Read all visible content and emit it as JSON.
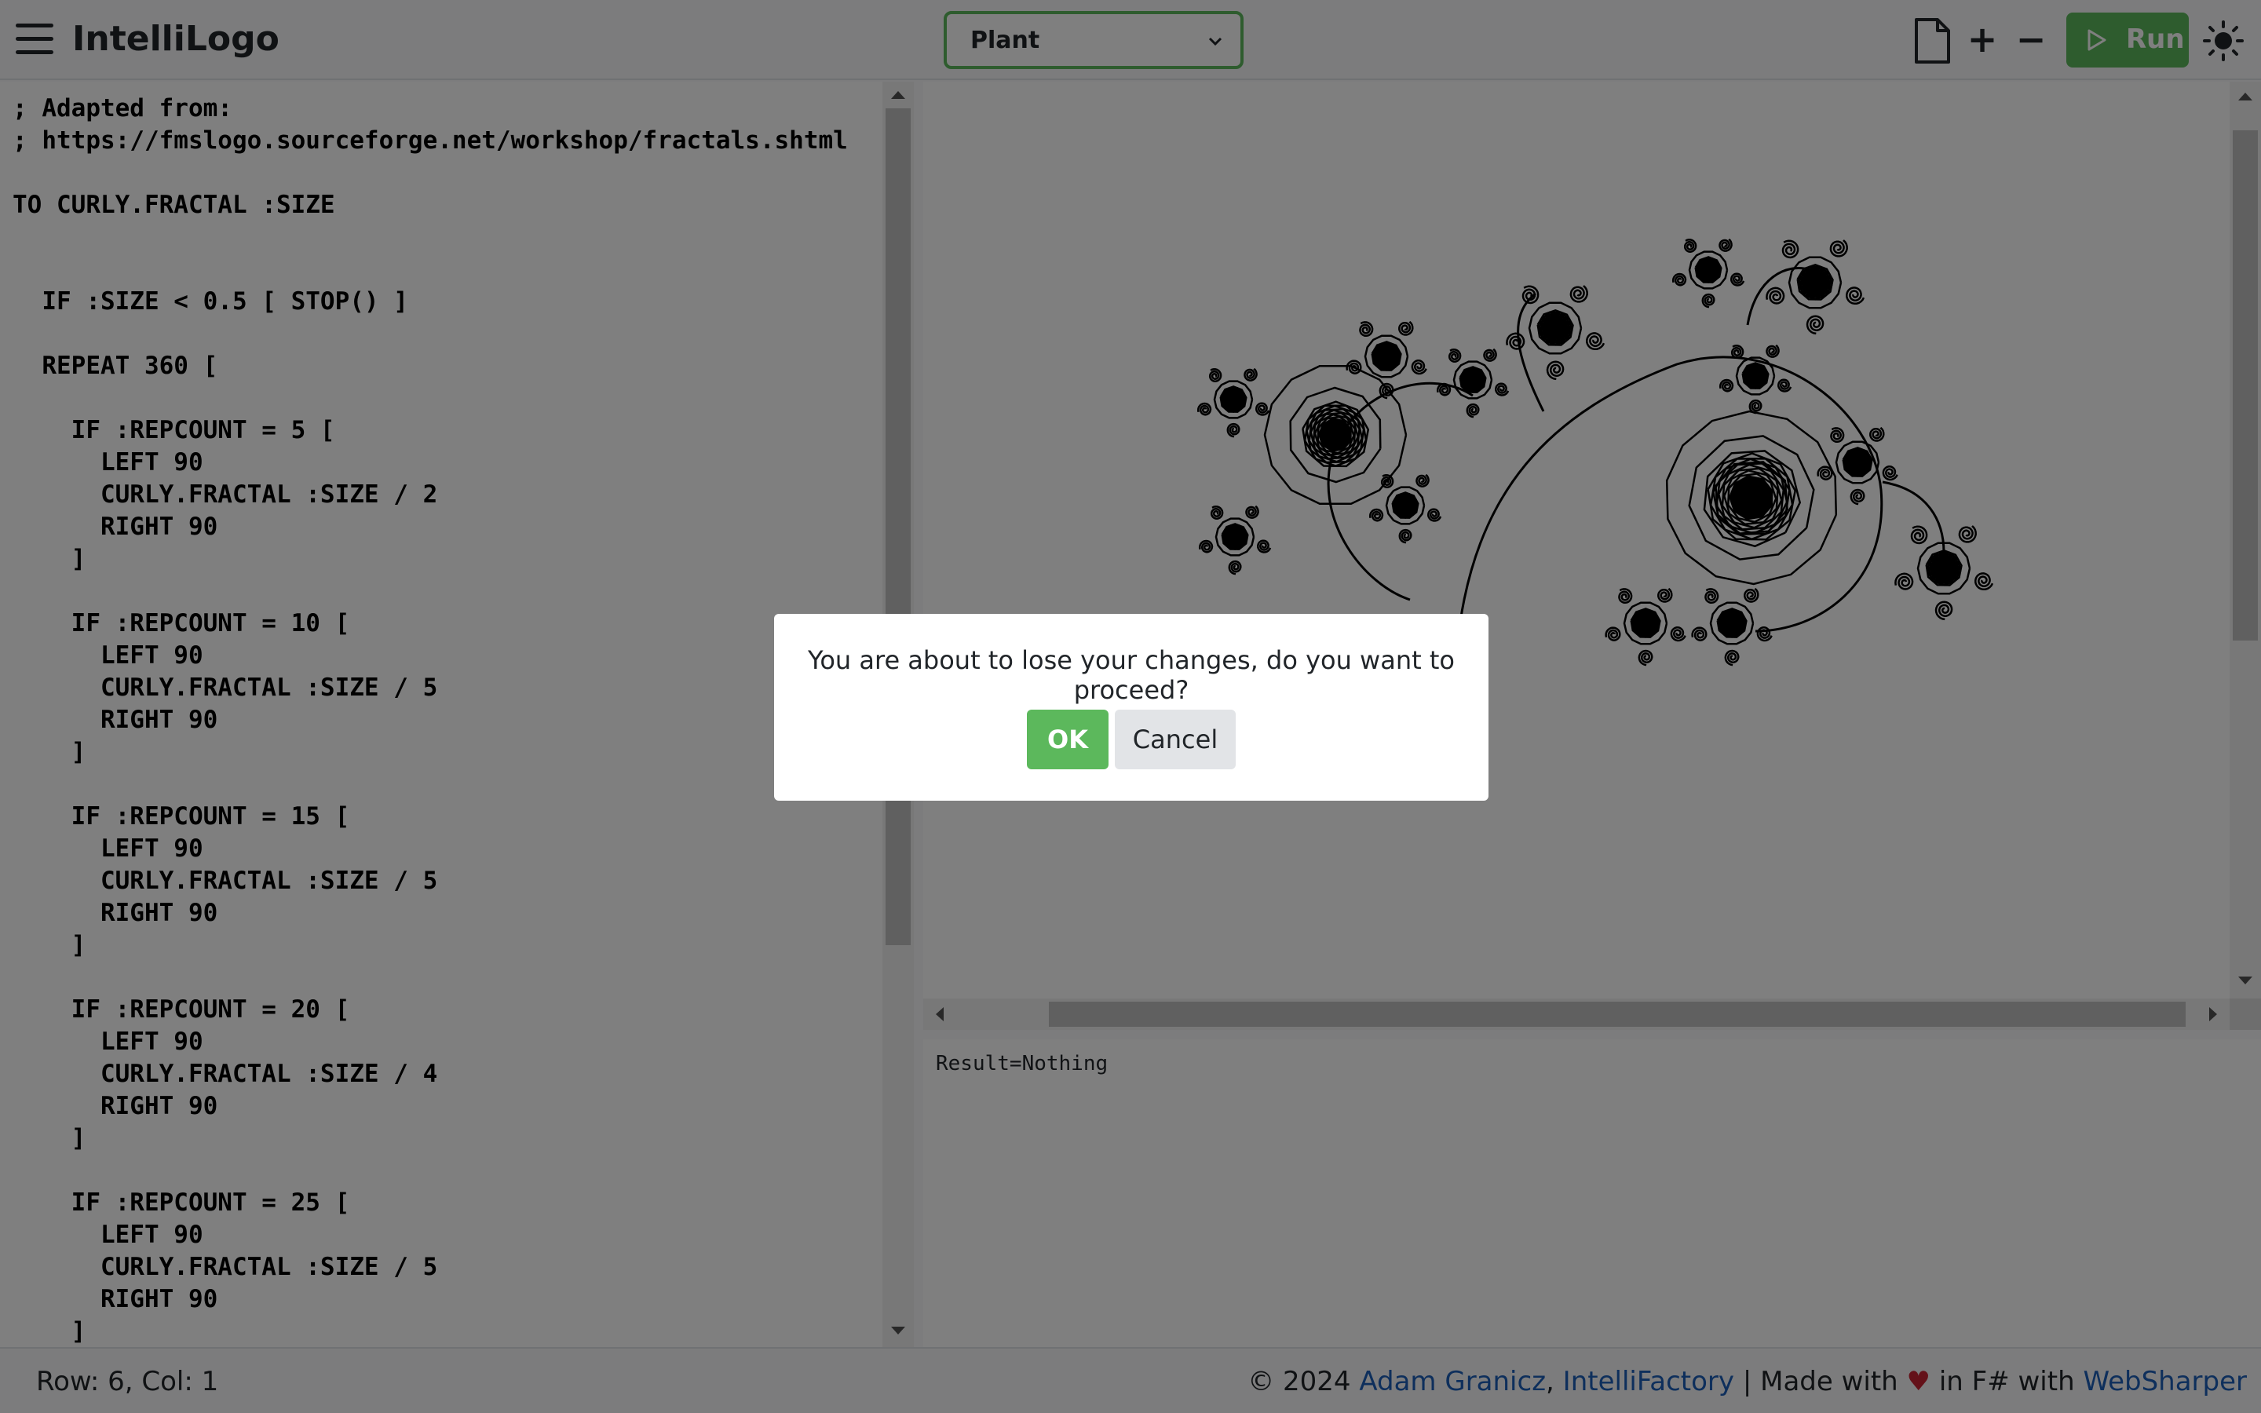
{
  "app": {
    "title": "IntelliLogo",
    "menu_icon": "hamburger-icon"
  },
  "toolbar": {
    "example_selected": "Plant",
    "new_file_icon": "new-file-icon",
    "zoom_in_label": "+",
    "zoom_out_label": "−",
    "run_label": "Run",
    "run_icon": "play-icon",
    "theme_icon": "sun-icon"
  },
  "editor": {
    "code": "; Adapted from:\n; https://fmslogo.sourceforge.net/workshop/fractals.shtml\n\nTO CURLY.FRACTAL :SIZE\n\n\n  IF :SIZE < 0.5 [ STOP() ]\n\n  REPEAT 360 [\n\n    IF :REPCOUNT = 5 [\n      LEFT 90\n      CURLY.FRACTAL :SIZE / 2\n      RIGHT 90\n    ]\n\n    IF :REPCOUNT = 10 [\n      LEFT 90\n      CURLY.FRACTAL :SIZE / 5\n      RIGHT 90\n    ]\n\n    IF :REPCOUNT = 15 [\n      LEFT 90\n      CURLY.FRACTAL :SIZE / 5\n      RIGHT 90\n    ]\n\n    IF :REPCOUNT = 20 [\n      LEFT 90\n      CURLY.FRACTAL :SIZE / 4\n      RIGHT 90\n    ]\n\n    IF :REPCOUNT = 25 [\n      LEFT 90\n      CURLY.FRACTAL :SIZE / 5\n      RIGHT 90\n    ]"
  },
  "output": {
    "text": "Result=Nothing"
  },
  "status_bar": {
    "cursor": "Row: 6, Col: 1"
  },
  "footer": {
    "copyright": "© 2024 ",
    "author": "Adam Granicz",
    "sep1": ", ",
    "company": "IntelliFactory",
    "made_with": " | Made with ",
    "heart": "♥",
    "in_fsharp": " in F# with ",
    "framework": "WebSharper",
    "link_color": "#1c5fb8"
  },
  "dialog": {
    "message": "You are about to lose your changes, do you want to proceed?",
    "ok_label": "OK",
    "cancel_label": "Cancel"
  },
  "colors": {
    "accent": "#5cb85c",
    "backdrop": "rgba(0,0,0,0.5)"
  }
}
